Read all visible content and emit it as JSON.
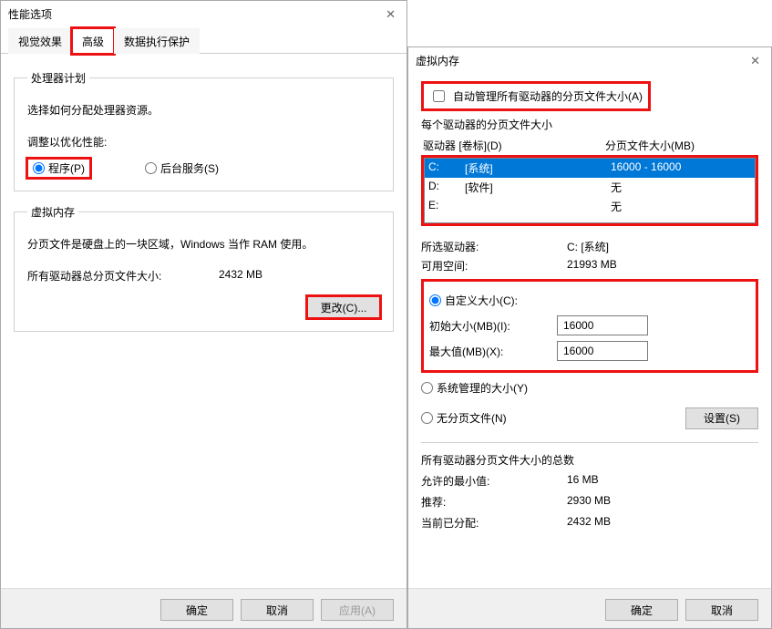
{
  "dlg1": {
    "title": "性能选项",
    "tabs": {
      "visual": "视觉效果",
      "advanced": "高级",
      "dep": "数据执行保护"
    },
    "proc": {
      "legend": "处理器计划",
      "desc": "选择如何分配处理器资源。",
      "adjust_label": "调整以优化性能:",
      "opt_programs": "程序(P)",
      "opt_bg": "后台服务(S)"
    },
    "vm": {
      "legend": "虚拟内存",
      "desc": "分页文件是硬盘上的一块区域，Windows 当作 RAM 使用。",
      "total_label": "所有驱动器总分页文件大小:",
      "total_value": "2432 MB",
      "change_btn": "更改(C)..."
    },
    "footer": {
      "ok": "确定",
      "cancel": "取消",
      "apply": "应用(A)"
    }
  },
  "dlg2": {
    "title": "虚拟内存",
    "auto_manage": "自动管理所有驱动器的分页文件大小(A)",
    "each_drive_legend": "每个驱动器的分页文件大小",
    "col_drive": "驱动器 [卷标](D)",
    "col_size": "分页文件大小(MB)",
    "drives": [
      {
        "letter": "C:",
        "label": "[系统]",
        "size": "16000 - 16000",
        "selected": true
      },
      {
        "letter": "D:",
        "label": "[软件]",
        "size": "无",
        "selected": false
      },
      {
        "letter": "E:",
        "label": "",
        "size": "无",
        "selected": false
      }
    ],
    "selected_drive_label": "所选驱动器:",
    "selected_drive_value": "C:  [系统]",
    "free_space_label": "可用空间:",
    "free_space_value": "21993 MB",
    "custom_size": "自定义大小(C):",
    "initial_label": "初始大小(MB)(I):",
    "initial_value": "16000",
    "max_label": "最大值(MB)(X):",
    "max_value": "16000",
    "system_managed": "系统管理的大小(Y)",
    "no_paging": "无分页文件(N)",
    "set_btn": "设置(S)",
    "totals_legend": "所有驱动器分页文件大小的总数",
    "min_label": "允许的最小值:",
    "min_value": "16 MB",
    "rec_label": "推荐:",
    "rec_value": "2930 MB",
    "cur_label": "当前已分配:",
    "cur_value": "2432 MB",
    "footer": {
      "ok": "确定",
      "cancel": "取消"
    }
  }
}
